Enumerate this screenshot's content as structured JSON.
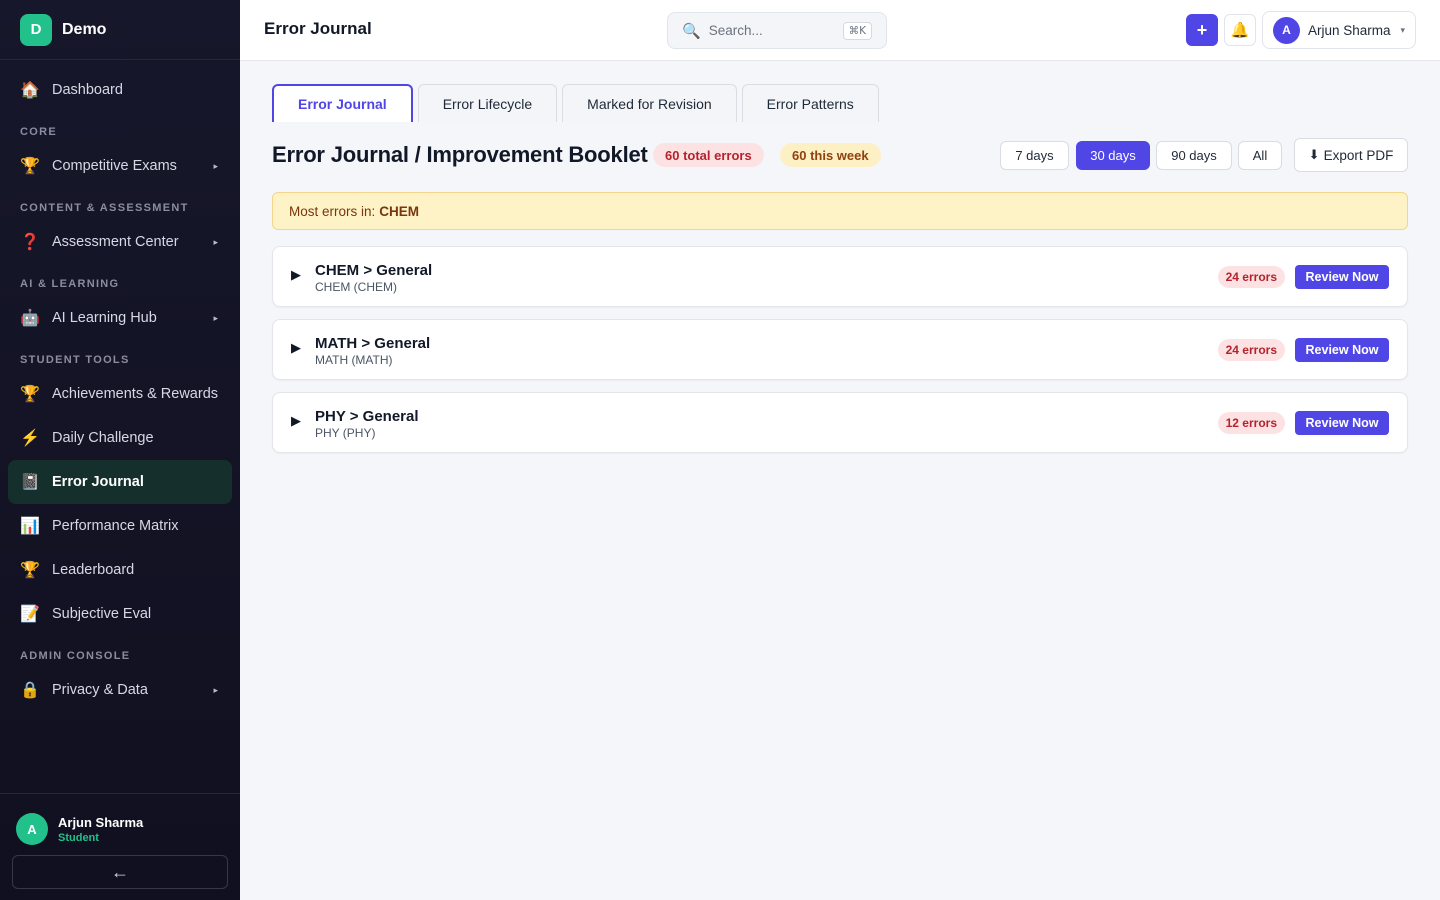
{
  "app": {
    "logo_letter": "D",
    "name": "Demo"
  },
  "sidebar": {
    "dashboard": {
      "icon": "house-icon",
      "glyph": "🏠",
      "label": "Dashboard"
    },
    "sections": [
      {
        "label": "CORE"
      },
      {
        "label": "CONTENT & ASSESSMENT"
      },
      {
        "label": "AI & LEARNING"
      },
      {
        "label": "STUDENT TOOLS"
      },
      {
        "label": "ADMIN CONSOLE"
      }
    ],
    "items": [
      {
        "icon": "trophy-icon",
        "glyph": "🏆",
        "label": "Competitive Exams"
      },
      {
        "icon": "question-icon",
        "glyph": "❓",
        "label": "Assessment Center"
      },
      {
        "icon": "robot-icon",
        "glyph": "🤖",
        "label": "AI Learning Hub"
      },
      {
        "icon": "trophy-icon",
        "glyph": "🏆",
        "label": "Achievements & Rewards"
      },
      {
        "icon": "lightning-icon",
        "glyph": "⚡",
        "label": "Daily Challenge"
      },
      {
        "icon": "notebook-icon",
        "glyph": "📓",
        "label": "Error Journal"
      },
      {
        "icon": "bar-chart-icon",
        "glyph": "📊",
        "label": "Performance Matrix"
      },
      {
        "icon": "trophy-icon",
        "glyph": "🏆",
        "label": "Leaderboard"
      },
      {
        "icon": "memo-icon",
        "glyph": "📝",
        "label": "Subjective Eval"
      },
      {
        "icon": "lock-icon",
        "glyph": "🔒",
        "label": "Privacy & Data"
      }
    ],
    "caret_glyph": "▸",
    "user": {
      "avatar_letter": "A",
      "name": "Arjun Sharma",
      "role": "Student"
    },
    "collapse_glyph": "←"
  },
  "topbar": {
    "title": "Error Journal",
    "search": {
      "icon": "search-icon",
      "glyph": "🔍",
      "placeholder": "Search...",
      "shortcut": "⌘K"
    },
    "add_glyph": "+",
    "bell_glyph": "🔔",
    "user": {
      "avatar_letter": "A",
      "name": "Arjun Sharma",
      "caret": "▾"
    }
  },
  "main": {
    "tabs": [
      {
        "label": "Error Journal",
        "active": true
      },
      {
        "label": "Error Lifecycle"
      },
      {
        "label": "Marked for Revision"
      },
      {
        "label": "Error Patterns"
      }
    ],
    "heading": "Error Journal / Improvement Booklet",
    "total_badge": "60 total errors",
    "week_badge": "60 this week",
    "ranges": [
      {
        "label": "7 days"
      },
      {
        "label": "30 days",
        "active": true
      },
      {
        "label": "90 days"
      },
      {
        "label": "All"
      }
    ],
    "export": {
      "glyph": "⬇",
      "label": "Export PDF"
    },
    "alert": {
      "prefix": "Most errors in:",
      "subject": "CHEM"
    },
    "groups": [
      {
        "expand_glyph": "▶",
        "title": "CHEM > General",
        "subtitle": "CHEM (CHEM)",
        "count": "24 errors",
        "action": "Review Now"
      },
      {
        "expand_glyph": "▶",
        "title": "MATH > General",
        "subtitle": "MATH (MATH)",
        "count": "24 errors",
        "action": "Review Now"
      },
      {
        "expand_glyph": "▶",
        "title": "PHY > General",
        "subtitle": "PHY (PHY)",
        "count": "12 errors",
        "action": "Review Now"
      }
    ]
  },
  "colors": {
    "accent": "#4f46e5",
    "brand": "#22c08a",
    "sidebar_bg": "#17172b",
    "danger_bg": "#fde2e4",
    "danger_text": "#b4232c",
    "warning_bg": "#fef3c7"
  }
}
